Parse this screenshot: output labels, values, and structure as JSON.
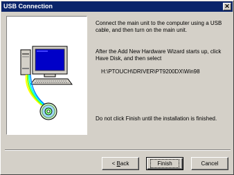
{
  "window": {
    "title": "USB Connection",
    "close_glyph": "✕"
  },
  "content": {
    "para1": "Connect the main unit to the computer using a USB cable, and then turn on the main unit.",
    "para2": "After the Add New Hardware Wizard starts up, click Have Disk, and then select",
    "path": "H:\\PTOUCH\\DRIVER\\PT9200DX\\Win98",
    "para3": "Do not click Finish until the installation is finished."
  },
  "buttons": {
    "back_prefix": "< ",
    "back_mnemonic": "B",
    "back_rest": "ack",
    "finish": "Finish",
    "cancel": "Cancel"
  },
  "icons": {
    "illustration": "computer-with-cd-icon"
  },
  "colors": {
    "titlebar": "#0a246a",
    "dialog_bg": "#d4d0c8",
    "screen_blue": "#0000c8"
  }
}
